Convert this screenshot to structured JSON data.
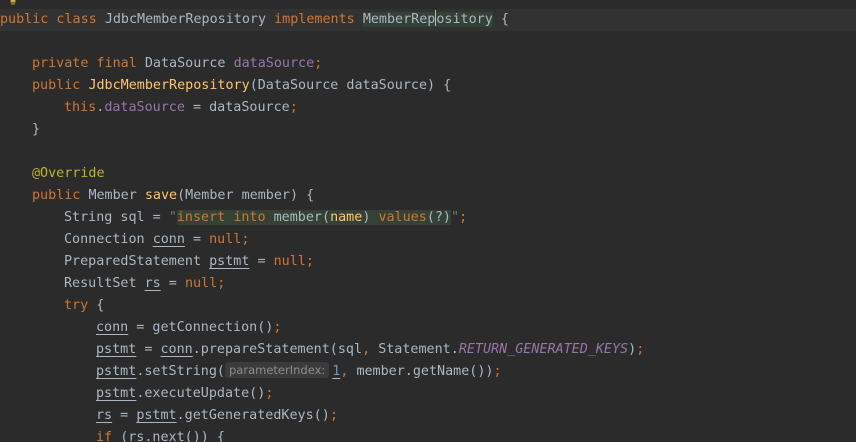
{
  "editor": {
    "lines": {
      "l1": {
        "t1": "public class ",
        "t2": "JdbcMemberRepository",
        "t3": " implements ",
        "t4a": "MemberRep",
        "t4b": "ository",
        "t5": " {"
      },
      "l2": {
        "t1": "private final ",
        "t2": "DataSource ",
        "t3": "dataSource",
        "t4": ";"
      },
      "l3": {
        "t1": "public ",
        "t2": "JdbcMemberRepository",
        "t3": "(DataSource dataSource) {"
      },
      "l4": {
        "t1": "this",
        "t2": ".",
        "t3": "dataSource",
        "t4": " = dataSource",
        "t5": ";"
      },
      "l5": {
        "t1": "}"
      },
      "l6": {
        "t1": "@Override"
      },
      "l7": {
        "t1": "public ",
        "t2": "Member ",
        "t3": "save",
        "t4": "(Member member) {"
      },
      "l8": {
        "t1": "String sql = ",
        "t2": "\"",
        "s1": "insert ",
        "s2": "into ",
        "s3": "member(",
        "s4": "name",
        "s5": ") ",
        "s6": "values",
        "s7": "(?)",
        "t3": "\"",
        "t4": ";"
      },
      "l9": {
        "t1": "Connection ",
        "t2": "conn",
        "t3": " = ",
        "t4": "null",
        "t5": ";"
      },
      "l10": {
        "t1": "PreparedStatement ",
        "t2": "pstmt",
        "t3": " = ",
        "t4": "null",
        "t5": ";"
      },
      "l11": {
        "t1": "ResultSet ",
        "t2": "rs",
        "t3": " = ",
        "t4": "null",
        "t5": ";"
      },
      "l12": {
        "t1": "try ",
        "t2": "{"
      },
      "l13": {
        "t1": "conn",
        "t2": " = getConnection()",
        "t3": ";"
      },
      "l14": {
        "t1": "pstmt",
        "t2": " = ",
        "t3": "conn",
        "t4": ".prepareStatement(sql",
        "t5": ", ",
        "t6": "Statement.",
        "t7": "RETURN_GENERATED_KEYS",
        "t8": ")",
        "t9": ";"
      },
      "l15": {
        "t1": "pstmt",
        "t2": ".setString(",
        "hint": "parameterIndex:",
        "t3": "1",
        "t4": ", ",
        "t5": "member.getName())",
        "t6": ";"
      },
      "l16": {
        "t1": "pstmt",
        "t2": ".executeUpdate()",
        "t3": ";"
      },
      "l17": {
        "t1": "rs",
        "t2": " = ",
        "t3": "pstmt",
        "t4": ".getGeneratedKeys()",
        "t5": ";"
      },
      "l18": {
        "t1": "if ",
        "t2": "(",
        "t3": "rs",
        "t4": ".next()) {"
      }
    },
    "colors": {
      "background": "#2b2b2b",
      "keyword": "#cc7832",
      "function": "#ffc66d",
      "field": "#9876aa",
      "string": "#6a8759",
      "number": "#6897bb",
      "annotation": "#bbb529"
    },
    "icons": {
      "gutter": "lightbulb-icon"
    }
  }
}
